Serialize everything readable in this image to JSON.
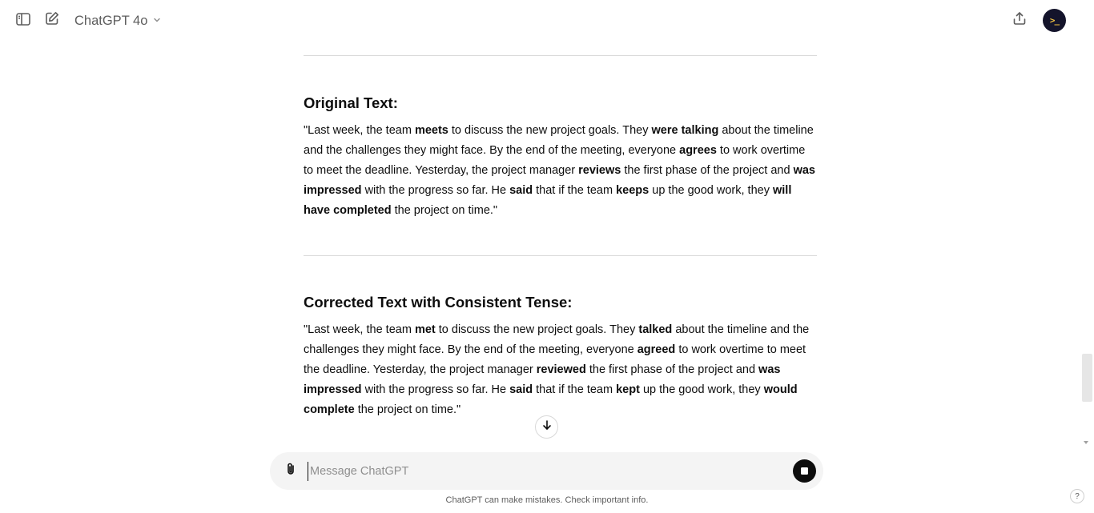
{
  "header": {
    "model_name": "ChatGPT 4o",
    "sidebar_toggle_icon": "sidebar-icon",
    "new_chat_icon": "edit-icon",
    "share_icon": "share-icon",
    "avatar_text": ">_"
  },
  "sections": [
    {
      "title": "Original Text:",
      "paragraph": [
        {
          "t": "\"Last week, the team ",
          "b": false
        },
        {
          "t": "meets",
          "b": true
        },
        {
          "t": " to discuss the new project goals. They ",
          "b": false
        },
        {
          "t": "were talking",
          "b": true
        },
        {
          "t": " about the timeline and the challenges they might face. By the end of the meeting, everyone ",
          "b": false
        },
        {
          "t": "agrees",
          "b": true
        },
        {
          "t": " to work overtime to meet the deadline. Yesterday, the project manager ",
          "b": false
        },
        {
          "t": "reviews",
          "b": true
        },
        {
          "t": " the first phase of the project and ",
          "b": false
        },
        {
          "t": "was impressed",
          "b": true
        },
        {
          "t": " with the progress so far. He ",
          "b": false
        },
        {
          "t": "said",
          "b": true
        },
        {
          "t": " that if the team ",
          "b": false
        },
        {
          "t": "keeps",
          "b": true
        },
        {
          "t": " up the good work, they ",
          "b": false
        },
        {
          "t": "will have completed",
          "b": true
        },
        {
          "t": " the project on time.\"",
          "b": false
        }
      ]
    },
    {
      "title": "Corrected Text with Consistent Tense:",
      "paragraph": [
        {
          "t": "\"Last week, the team ",
          "b": false
        },
        {
          "t": "met",
          "b": true
        },
        {
          "t": " to discuss the new project goals. They ",
          "b": false
        },
        {
          "t": "talked",
          "b": true
        },
        {
          "t": " about the timeline and the challenges they might face. By the end of the meeting, everyone ",
          "b": false
        },
        {
          "t": "agreed",
          "b": true
        },
        {
          "t": " to work overtime to meet the deadline. Yesterday, the project manager ",
          "b": false
        },
        {
          "t": "reviewed",
          "b": true
        },
        {
          "t": " the first phase of the project and ",
          "b": false
        },
        {
          "t": "was impressed",
          "b": true
        },
        {
          "t": " with the progress so far. He ",
          "b": false
        },
        {
          "t": "said",
          "b": true
        },
        {
          "t": " that if the team ",
          "b": false
        },
        {
          "t": "kept",
          "b": true
        },
        {
          "t": " up the good work, they ",
          "b": false
        },
        {
          "t": "would complete",
          "b": true
        },
        {
          "t": " the project on time.\"",
          "b": false
        }
      ]
    }
  ],
  "composer": {
    "placeholder": "Message ChatGPT",
    "attach_icon": "paperclip-icon",
    "stop_icon": "stop-icon"
  },
  "footer": {
    "disclaimer": "ChatGPT can make mistakes. Check important info.",
    "help_label": "?"
  }
}
